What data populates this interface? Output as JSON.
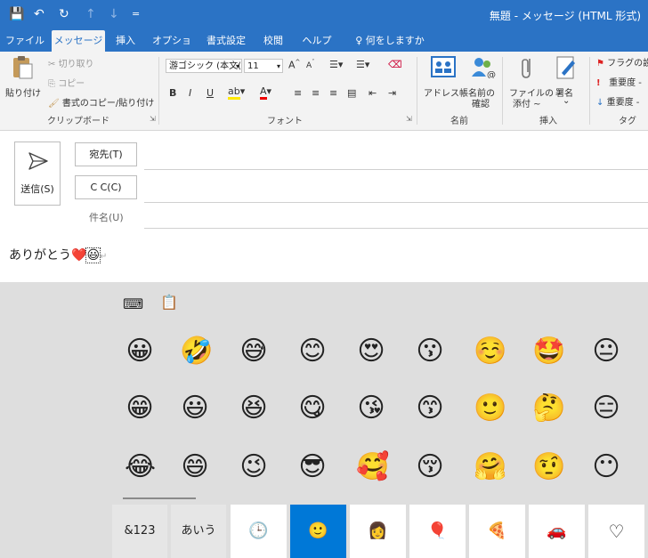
{
  "title_bar": {
    "save_icon": "💾",
    "undo_icon": "↶",
    "redo_icon": "↻",
    "up_icon": "↑",
    "down_icon": "↓",
    "customize_icon": "=",
    "title": "無題 - メッセージ (HTML 形式)"
  },
  "tabs": [
    "ファイル",
    "メッセージ",
    "挿入",
    "オプション",
    "書式設定",
    "校閲",
    "ヘルプ",
    "何をしますか"
  ],
  "tell_me_icon": "♀",
  "ribbon": {
    "clipboard": {
      "paste": "貼り付け",
      "cut": "切り取り",
      "copy": "コピー",
      "format_painter": "書式のコピー/貼り付け",
      "group": "クリップボード"
    },
    "font": {
      "font_name": "游ゴシック (本文(",
      "font_size": "11",
      "group": "フォント"
    },
    "names": {
      "address_book": "アドレス帳",
      "check_names_1": "名前の",
      "check_names_2": "確認",
      "group": "名前"
    },
    "include": {
      "attach_1": "ファイルの",
      "attach_2": "添付 ~",
      "signature": "署名",
      "group": "挿入"
    },
    "tags": {
      "flag": "フラグの設",
      "importance_high": "重要度 -",
      "importance_low": "重要度 -",
      "group": "タグ"
    }
  },
  "compose": {
    "send": "送信(S)",
    "to": "宛先(T)",
    "cc": "C C(C)",
    "subject": "件名(U)",
    "body_text": "ありがとう",
    "body_emoji_1": "❤️",
    "body_emoji_2": "😃",
    "cursor_mark": "↵"
  },
  "emoji_panel": {
    "keyboard_icon": "⌨",
    "clipboard_icon": "📋",
    "rows": [
      [
        "😀",
        "🤣",
        "😅",
        "😊",
        "😍",
        "😗",
        "☺️",
        "🤩",
        "😐"
      ],
      [
        "😁",
        "😃",
        "😆",
        "😋",
        "😘",
        "😙",
        "🙂",
        "🤔",
        "😑"
      ],
      [
        "😂",
        "😄",
        "😉",
        "😎",
        "🥰",
        "😚",
        "🤗",
        "🤨",
        "😶"
      ]
    ],
    "categories": [
      "&123",
      "あいう",
      "🕒",
      "🙂",
      "👩",
      "🎈",
      "🍕",
      "🚗",
      "♡"
    ]
  }
}
